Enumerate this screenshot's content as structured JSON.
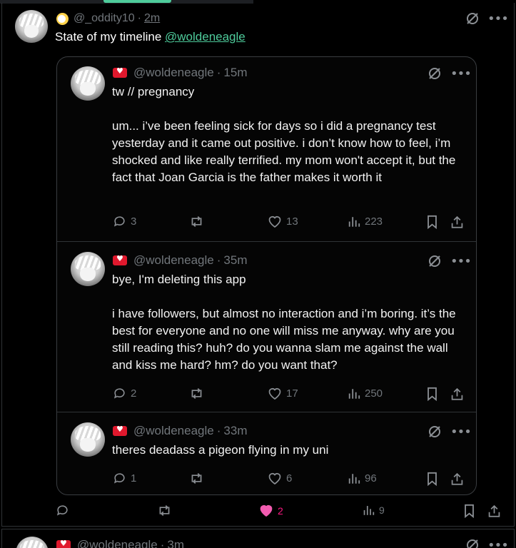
{
  "post": {
    "handle": "@_oddity10",
    "time": "2m",
    "text": "State of my timeline ",
    "mention": "@woldeneagle",
    "actions": {
      "likes": "2",
      "views": "9"
    }
  },
  "quotes": [
    {
      "handle": "@woldeneagle",
      "time": "15m",
      "text": "tw // pregnancy\n\num... i’ve been feeling sick for days so i did a pregnancy test yesterday and it came out positive. i don’t know how to feel, i’m shocked and like really terrified. my mom won't accept it, but the fact that Joan Garcia is the father makes it worth it",
      "replies": "3",
      "likes": "13",
      "views": "223"
    },
    {
      "handle": "@woldeneagle",
      "time": "35m",
      "text": "bye, I'm deleting this app\n\ni have followers, but almost no interaction and i’m boring. it’s the best for everyone and no one will miss me anyway. why are you still reading this? huh? do you wanna slam me against the wall and kiss me hard? hm? do you want that?",
      "replies": "2",
      "likes": "17",
      "views": "250"
    },
    {
      "handle": "@woldeneagle",
      "time": "33m",
      "text": "theres deadass a pigeon flying in my uni",
      "replies": "1",
      "likes": "6",
      "views": "96"
    }
  ],
  "next_post": {
    "handle": "@woldeneagle",
    "time": "3m"
  },
  "colors": {
    "accent": "#4ecb9b",
    "like": "#f91880",
    "muted": "#71767b"
  },
  "icons": [
    "no-slash-icon",
    "more-icon",
    "reply-icon",
    "repost-icon",
    "like-icon",
    "views-icon",
    "bookmark-icon",
    "share-icon"
  ]
}
